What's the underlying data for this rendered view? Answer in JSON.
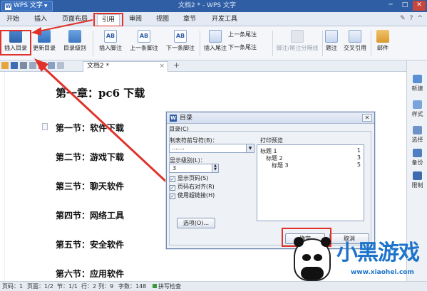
{
  "titlebar": {
    "app_button": "WPS 文字",
    "document_title": "文档2 * - WPS 文字"
  },
  "menu": {
    "tabs": [
      "开始",
      "插入",
      "页面布局",
      "引用",
      "审阅",
      "视图",
      "章节",
      "开发工具"
    ],
    "active_tab": "引用"
  },
  "ribbon": {
    "insert_toc": "插入目录",
    "update_toc": "更新目录",
    "toc_level": "目录级别",
    "insert_footnote": "插入脚注",
    "prev_footnote": "上一条脚注",
    "next_footnote": "下一条脚注",
    "insert_endnote": "插入尾注",
    "prev_endnote": "上一条尾注",
    "next_endnote": "下一条尾注",
    "separator": "脚注/尾注分隔线",
    "caption": "题注",
    "cross_ref": "交叉引用",
    "mail": "邮件"
  },
  "document_tab": {
    "label": "文档2 *",
    "close": "×",
    "new": "+"
  },
  "document": {
    "heading": "第一章：pc6 下载",
    "sections": [
      "第一节：软件下载",
      "第二节：游戏下载",
      "第三节：聊天软件",
      "第四节：网络工具",
      "第五节：安全软件",
      "第六节：应用软件"
    ]
  },
  "right_panel": {
    "items": [
      "新建",
      "样式",
      "选择",
      "备份",
      "限制"
    ]
  },
  "dialog": {
    "title": "目录",
    "group_label": "目录(C)",
    "leader_label": "制表符前导符(B)：",
    "leader_value": ".......",
    "preview_label": "打印预览",
    "levels_label": "显示级别(L)：",
    "levels_value": "3",
    "show_page_numbers": "显示页码(S)",
    "right_align": "页码右对齐(R)",
    "use_hyperlinks": "使用超链接(H)",
    "options_button": "选项(O)...",
    "ok_button": "确定",
    "cancel_button": "取消",
    "preview_lines": [
      {
        "text": "标题 1",
        "page": "1"
      },
      {
        "text": "标题 2",
        "page": "3"
      },
      {
        "text": "标题 3",
        "page": "5"
      }
    ]
  },
  "statusbar": {
    "page_num": "页码：1",
    "pages": "页面：1/2",
    "section": "节：1/1",
    "row": "行：2",
    "col": "列：9",
    "word_count": "字数：148",
    "spell": "拼写检查"
  },
  "watermark": {
    "text": "小黑游戏",
    "url": "www.xiaohei.com"
  },
  "colors": {
    "title_bar": "#2f5ea5",
    "highlight": "#e0322a",
    "watermark": "#1e74c9"
  }
}
